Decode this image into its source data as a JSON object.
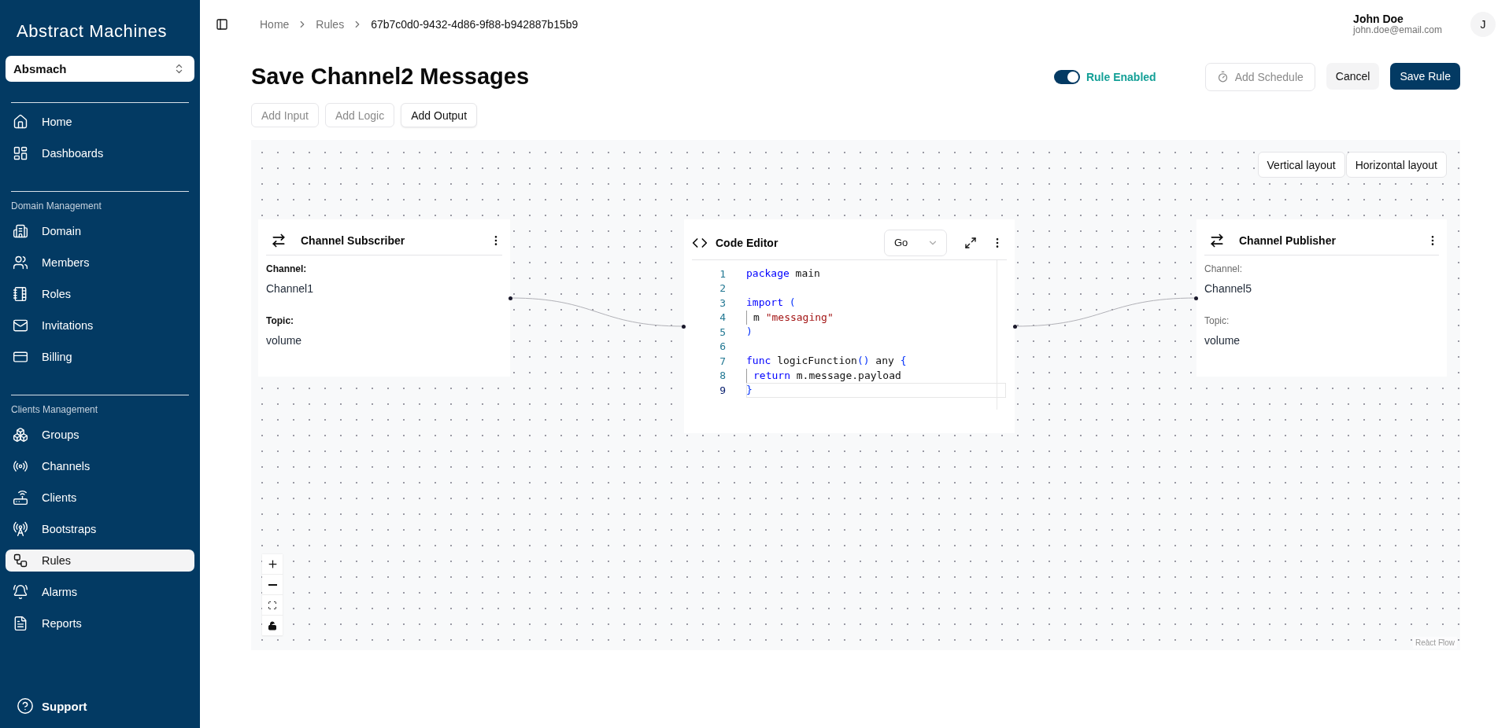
{
  "sidebar": {
    "logo": "Abstract Machines",
    "workspace": "Absmach",
    "sections": [
      {
        "items": [
          {
            "label": "Home",
            "selected": false
          },
          {
            "label": "Dashboards",
            "selected": false
          }
        ]
      },
      {
        "heading": "Domain Management",
        "items": [
          {
            "label": "Domain",
            "selected": false
          },
          {
            "label": "Members",
            "selected": false
          },
          {
            "label": "Roles",
            "selected": false
          },
          {
            "label": "Invitations",
            "selected": false
          },
          {
            "label": "Billing",
            "selected": false
          }
        ]
      },
      {
        "heading": "Clients Management",
        "items": [
          {
            "label": "Groups",
            "selected": false
          },
          {
            "label": "Channels",
            "selected": false
          },
          {
            "label": "Clients",
            "selected": false
          },
          {
            "label": "Bootstraps",
            "selected": false
          },
          {
            "label": "Rules",
            "selected": true
          },
          {
            "label": "Alarms",
            "selected": false
          },
          {
            "label": "Reports",
            "selected": false
          }
        ]
      }
    ],
    "support": "Support"
  },
  "header": {
    "breadcrumbs": [
      "Home",
      "Rules",
      "67b7c0d0-9432-4d86-9f88-b942887b15b9"
    ],
    "user": {
      "name": "John Doe",
      "email": "john.doe@email.com",
      "initial": "J"
    }
  },
  "rule": {
    "title": "Save Channel2 Messages",
    "enabled": true,
    "enabled_label": "Rule Enabled",
    "actions": [
      {
        "label": "Add Schedule",
        "kind": "outline",
        "disabled": true
      },
      {
        "label": "Cancel",
        "kind": "secondary",
        "disabled": false
      },
      {
        "label": "Save Rule",
        "kind": "primary",
        "disabled": false
      }
    ],
    "add_buttons": [
      {
        "label": "Add Input",
        "disabled": true
      },
      {
        "label": "Add Logic",
        "disabled": true
      },
      {
        "label": "Add Output",
        "disabled": false
      }
    ]
  },
  "canvas": {
    "layout_buttons": [
      "Vertical layout",
      "Horizontal layout"
    ],
    "nodes": [
      {
        "kind": "input",
        "title": "Channel Subscriber",
        "fields": [
          {
            "label": "Channel:",
            "value": "Channel1"
          },
          {
            "label": "Topic:",
            "value": "volume"
          }
        ]
      },
      {
        "kind": "logic",
        "title": "Code Editor",
        "language": "Go",
        "lines": [
          {
            "number": "1",
            "active": false,
            "indented": false,
            "tokens": [
              {
                "text": "package",
                "kind": "keyword"
              },
              {
                "text": " main",
                "kind": "plain"
              }
            ]
          },
          {
            "number": "2",
            "active": false
          },
          {
            "number": "3",
            "active": false,
            "indented": false,
            "tokens": [
              {
                "text": "import",
                "kind": "keyword"
              },
              {
                "text": " (",
                "kind": "bracket"
              }
            ]
          },
          {
            "number": "4",
            "active": false,
            "indented": true,
            "tokens": [
              {
                "text": "m ",
                "kind": "plain"
              },
              {
                "text": "\"messaging\"",
                "kind": "string"
              }
            ]
          },
          {
            "number": "5",
            "active": false,
            "indented": false,
            "tokens": [
              {
                "text": ")",
                "kind": "bracket"
              }
            ]
          },
          {
            "number": "6",
            "active": false
          },
          {
            "number": "7",
            "active": false,
            "indented": false,
            "tokens": [
              {
                "text": "func",
                "kind": "keyword"
              },
              {
                "text": " logicFunction",
                "kind": "plain"
              },
              {
                "text": "()",
                "kind": "bracket"
              },
              {
                "text": " any ",
                "kind": "plain"
              },
              {
                "text": "{",
                "kind": "bracket"
              }
            ]
          },
          {
            "number": "8",
            "active": false,
            "indented": true,
            "tokens": [
              {
                "text": "return",
                "kind": "keyword"
              },
              {
                "text": " m.message.payload",
                "kind": "plain"
              }
            ]
          },
          {
            "number": "9",
            "active": true,
            "indented": false,
            "tokens": [
              {
                "text": "}",
                "kind": "bracket"
              }
            ]
          }
        ]
      },
      {
        "kind": "output",
        "title": "Channel Publisher",
        "fields": [
          {
            "label": "Channel:",
            "value": "Channel5"
          },
          {
            "label": "Topic:",
            "value": "volume"
          }
        ]
      }
    ],
    "attribution": "React Flow"
  }
}
